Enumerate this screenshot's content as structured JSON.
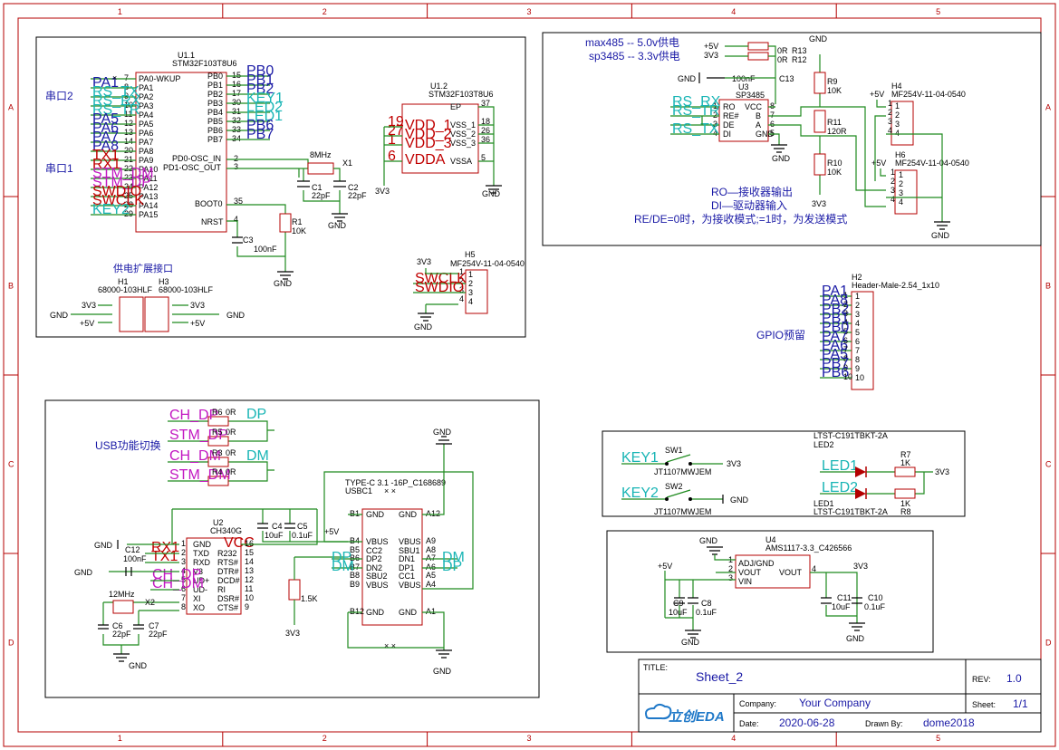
{
  "frame": {
    "col_labels": [
      "1",
      "2",
      "3",
      "4",
      "5"
    ],
    "row_labels": [
      "A",
      "B",
      "C",
      "D"
    ]
  },
  "title_block": {
    "title_label": "TITLE:",
    "title_value": "Sheet_2",
    "rev_label": "REV:",
    "rev_value": "1.0",
    "company_label": "Company:",
    "company_value": "Your Company",
    "sheet_label": "Sheet:",
    "sheet_value": "1/1",
    "date_label": "Date:",
    "date_value": "2020-06-28",
    "drawn_label": "Drawn By:",
    "drawn_value": "dome2018",
    "logo_text": "立创EDA"
  },
  "mcu": {
    "ref": "U1.1",
    "part": "STM32F103T8U6",
    "uart2_title": "串口2",
    "uart1_title": "串口1",
    "left_nets": [
      "PA1",
      "RS_TX",
      "RS_RX",
      "RS_TR",
      "PA5",
      "PA6",
      "PA7",
      "PA8",
      "TX1",
      "RX1",
      "STM_DM",
      "STM_DP",
      "SWDIO",
      "SWCLK",
      "KEY2"
    ],
    "left_nums": [
      "7",
      "8",
      "9",
      "10",
      "11",
      "12",
      "13",
      "14",
      "20",
      "21",
      "22",
      "23",
      "24",
      "25",
      "28",
      "29"
    ],
    "left_pins": [
      "PA0-WKUP",
      "PA1",
      "PA2",
      "PA3",
      "PA4",
      "PA5",
      "PA6",
      "PA7",
      "PA8",
      "PA9",
      "PA10",
      "PA11",
      "PA12",
      "PA13",
      "PA14",
      "PA15"
    ],
    "right_pins": [
      "PB0",
      "PB1",
      "PB2",
      "PB3",
      "PB4",
      "PB5",
      "PB6",
      "PB7"
    ],
    "right_nums": [
      "15",
      "16",
      "17",
      "30",
      "31",
      "32",
      "33",
      "34"
    ],
    "right_nets": [
      "PB0",
      "PB1",
      "PB2",
      "KEY1",
      "LED2",
      "LED1",
      "PB6",
      "PB7"
    ],
    "osc_in": "PD0-OSC_IN",
    "osc_out": "PD1-OSC_OUT",
    "osc_nums": [
      "2",
      "3"
    ],
    "boot0": "BOOT0",
    "boot0_num": "35",
    "nrst": "NRST",
    "nrst_num": "4",
    "crystal": "8MHz",
    "crystal_ref": "X1",
    "c1": "C1",
    "c1_val": "22pF",
    "c2": "C2",
    "c2_val": "22pF",
    "r1": "R1",
    "r1_val": "10K",
    "c3": "C3",
    "c3_val": "100nF",
    "gnd": "GND"
  },
  "mcu_power": {
    "ref": "U1.2",
    "part": "STM32F103T8U6",
    "left_nums": [
      "19",
      "27",
      "1",
      "6"
    ],
    "left_pins": [
      "VDD_1",
      "VDD_2",
      "VDD_3",
      "VDDA"
    ],
    "right_pins": [
      "EP",
      "VSS_1",
      "VSS_2",
      "VSS_3",
      "VSSA"
    ],
    "right_nums": [
      "37",
      "18",
      "26",
      "36",
      "5"
    ],
    "vcc": "3V3",
    "gnd": "GND"
  },
  "h5": {
    "ref": "H5",
    "part": "MF254V-11-04-0540",
    "nets": [
      "3V3",
      "SWCLK",
      "SWDIO",
      "GND"
    ],
    "pins": [
      "1",
      "2",
      "3",
      "4"
    ]
  },
  "power_ext": {
    "title": "供电扩展接口",
    "h1": "H1",
    "h1_part": "68000-103HLF",
    "h3": "H3",
    "h3_part": "68000-103HLF",
    "nets": [
      "3V3",
      "GND",
      "+5V"
    ],
    "pins": [
      "1",
      "2",
      "3"
    ]
  },
  "rs485": {
    "note1": "max485 -- 5.0v供电",
    "note2": "sp3485 -- 3.3v供电",
    "r13": "R13",
    "r12": "R12",
    "r_val": "0R",
    "net5v": "+5V",
    "net3v3": "3V3",
    "gnd": "GND",
    "c13": "C13",
    "c13_val": "100nF",
    "u3": "U3",
    "u3_part": "SP3485",
    "left_pins": [
      "RO",
      "RE#",
      "DE",
      "DI"
    ],
    "left_nums": [
      "1",
      "2",
      "3",
      "4"
    ],
    "left_nets": [
      "RS_RX",
      "RS_TR",
      "RS_TX"
    ],
    "right_pins": [
      "VCC",
      "B",
      "A",
      "GND"
    ],
    "right_nums": [
      "8",
      "7",
      "6",
      "5"
    ],
    "r9": "R9",
    "r9_val": "10K",
    "r11": "R11",
    "r11_val": "120R",
    "r10": "R10",
    "r10_val": "10K",
    "h4": "H4",
    "h6": "H6",
    "conn_part": "MF254V-11-04-0540",
    "conn_pins": [
      "1",
      "2",
      "3",
      "4"
    ],
    "desc1": "RO—接收器输出",
    "desc2": "DI—驱动器输入",
    "desc3": "RE/DE=0时，为接收模式;=1时，为发送模式"
  },
  "gpio": {
    "title": "GPIO预留",
    "ref": "H2",
    "part": "Header-Male-2.54_1x10",
    "nets": [
      "PA1",
      "PA8",
      "PB2",
      "PB1",
      "PB0",
      "PA7",
      "PA6",
      "PA5",
      "PB7",
      "PB6"
    ],
    "pins": [
      "1",
      "2",
      "3",
      "4",
      "5",
      "6",
      "7",
      "8",
      "9",
      "10"
    ]
  },
  "usb": {
    "title": "USB功能切换",
    "routes": [
      {
        "from": "CH_DP",
        "ref": "R6",
        "val": "0R",
        "to": "DP"
      },
      {
        "from": "STM_DP",
        "ref": "R5",
        "val": "0R",
        "to": ""
      },
      {
        "from": "CH_DM",
        "ref": "R3",
        "val": "0R",
        "to": "DM"
      },
      {
        "from": "STM_DM",
        "ref": "R4",
        "val": "0R",
        "to": ""
      }
    ],
    "u2": "U2",
    "u2_part": "CH340G",
    "left_pins": [
      "GND",
      "TXD",
      "RXD",
      "V3",
      "UD+",
      "UD-",
      "XI",
      "XO"
    ],
    "left_nums": [
      "1",
      "2",
      "3",
      "4",
      "5",
      "6",
      "7",
      "8"
    ],
    "left_nets": [
      "RX1",
      "TX1",
      "CH_DP",
      "CH_DM"
    ],
    "right_pins": [
      "VCC",
      "R232",
      "RTS#",
      "DTR#",
      "DCD#",
      "RI",
      "DSR#",
      "CTS#"
    ],
    "right_nums": [
      "16",
      "15",
      "14",
      "13",
      "12",
      "11",
      "10",
      "9"
    ],
    "c12": "C12",
    "c12_val": "100nF",
    "x2_freq": "12MHz",
    "x2": "X2",
    "c6": "C6",
    "c6_val": "22pF",
    "c7": "C7",
    "c7_val": "22pF",
    "c4": "C4",
    "c4_val": "10uF",
    "c5": "C5",
    "c5_val": "0.1uF",
    "net5v": "+5V",
    "gnd": "GND",
    "r2": "R2",
    "r2_val": "1.5K",
    "net3v3": "3V3",
    "usbc_part": "TYPE-C 3.1 -16P_C168689",
    "usbc_ref": "USBC1",
    "usbc_left_pins": [
      "GND",
      "VBUS",
      "CC2",
      "DP2",
      "DN2",
      "SBU2",
      "VBUS",
      "GND"
    ],
    "usbc_left_nums": [
      "B1",
      "B4",
      "B5",
      "B6",
      "B7",
      "B8",
      "B9",
      "B12"
    ],
    "usbc_right_pins": [
      "GND",
      "VBUS",
      "SBU1",
      "DN1",
      "DP1",
      "CC1",
      "VBUS",
      "GND"
    ],
    "usbc_right_nums": [
      "A12",
      "A9",
      "A8",
      "A7",
      "A6",
      "A5",
      "A4",
      "A1"
    ],
    "dp": "DP",
    "dm": "DM"
  },
  "keys_leds": {
    "key1": "KEY1",
    "sw1": "SW1",
    "sw1_part": "JT1107MWJEM",
    "key2": "KEY2",
    "sw2": "SW2",
    "sw2_part": "JT1107MWJEM",
    "net3v3": "3V3",
    "gnd": "GND",
    "led_part": "LTST-C191TBKT-2A",
    "led2": "LED2",
    "led1": "LED1",
    "r7": "R7",
    "r8": "R8",
    "r_val": "1K",
    "led1_net": "LED1",
    "led2_net": "LED2"
  },
  "ldo": {
    "u4": "U4",
    "part": "AMS1117-3.3_C426566",
    "pins": [
      "ADJ/GND",
      "VOUT",
      "VIN",
      "VOUT"
    ],
    "nums": [
      "1",
      "2",
      "3",
      "4"
    ],
    "gnd": "GND",
    "net5v": "+5V",
    "net3v3": "3V3",
    "c9": "C9",
    "c9_val": "10uF",
    "c8": "C8",
    "c8_val": "0.1uF",
    "c11": "C11",
    "c11_val": "10uF",
    "c10": "C10",
    "c10_val": "0.1uF"
  }
}
